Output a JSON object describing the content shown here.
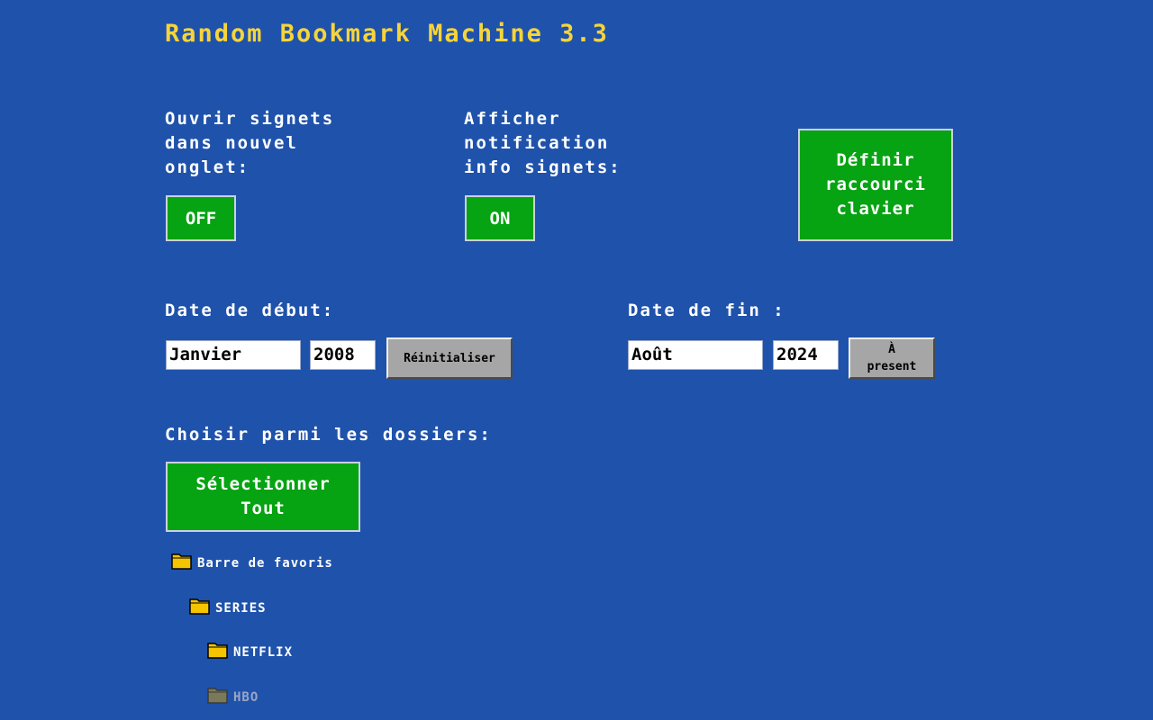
{
  "app": {
    "title": "Random Bookmark Machine 3.3"
  },
  "options": {
    "open_new_tab_label": "Ouvrir signets\ndans nouvel\nonglet:",
    "open_new_tab_value": "OFF",
    "notification_label": "Afficher\nnotification\ninfo signets:",
    "notification_value": "ON",
    "shortcut_button": "Définir\nraccourci\nclavier"
  },
  "dates": {
    "start_label": "Date de début:",
    "start_month": "Janvier",
    "start_year": "2008",
    "reset_button": "Réinitialiser",
    "end_label": "Date de fin :",
    "end_month": "Août",
    "end_year": "2024",
    "present_button": "À\npresent"
  },
  "folders": {
    "label": "Choisir parmi les dossiers:",
    "select_all_button": "Sélectionner\nTout",
    "items": [
      {
        "label": "Barre de favoris",
        "icon": "folder-icon",
        "enabled": true
      },
      {
        "label": "SERIES",
        "icon": "folder-icon",
        "enabled": true
      },
      {
        "label": "NETFLIX",
        "icon": "folder-icon",
        "enabled": true
      },
      {
        "label": "HBO",
        "icon": "folder-icon",
        "enabled": false
      }
    ]
  },
  "colors": {
    "background": "#1f52ab",
    "title": "#f6d43a",
    "button_green": "#06a312",
    "button_grey": "#a6a6a6",
    "folder_enabled": "#f5c400",
    "folder_disabled": "#7a7a5a"
  }
}
